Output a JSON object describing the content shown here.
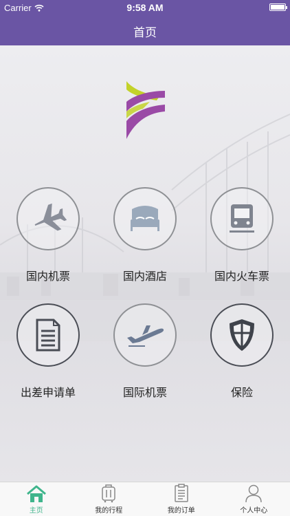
{
  "status_bar": {
    "carrier": "Carrier",
    "time": "9:58 AM",
    "icons": [
      "wifi-icon",
      "battery-icon"
    ]
  },
  "header": {
    "title": "首页"
  },
  "colors": {
    "header": "#6a55a4",
    "active_tab": "#3fb58c",
    "logo_green": "#c3d22a",
    "logo_purple": "#9a4aa6"
  },
  "services": [
    {
      "label": "国内机票",
      "icon": "airplane-icon"
    },
    {
      "label": "国内酒店",
      "icon": "hotel-bed-icon"
    },
    {
      "label": "国内火车票",
      "icon": "train-icon"
    },
    {
      "label": "出差申请单",
      "icon": "document-icon"
    },
    {
      "label": "国际机票",
      "icon": "airplane-takeoff-icon"
    },
    {
      "label": "保险",
      "icon": "shield-icon"
    }
  ],
  "tabs": [
    {
      "label": "主页",
      "icon": "home-icon",
      "active": true
    },
    {
      "label": "我的行程",
      "icon": "luggage-icon",
      "active": false
    },
    {
      "label": "我的订单",
      "icon": "clipboard-icon",
      "active": false
    },
    {
      "label": "个人中心",
      "icon": "person-icon",
      "active": false
    }
  ]
}
